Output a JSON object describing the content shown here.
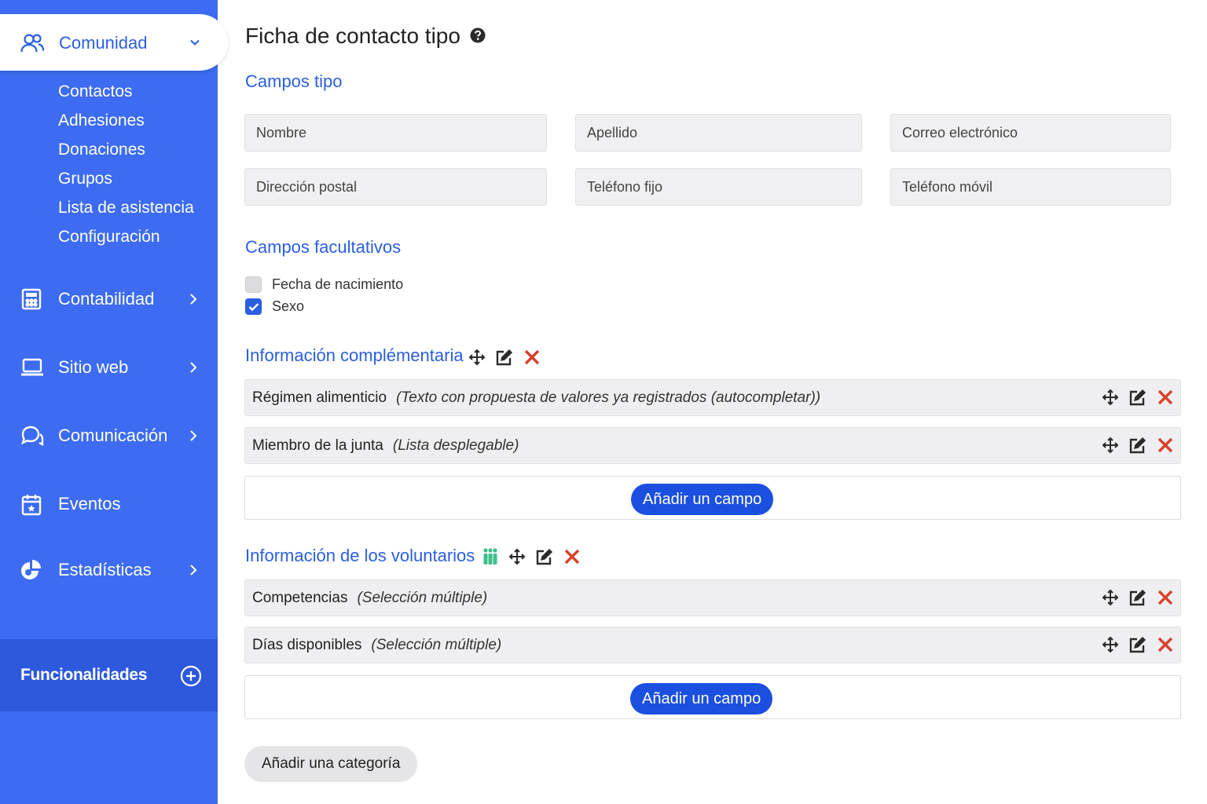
{
  "sidebar": {
    "active": {
      "label": "Comunidad",
      "icon": "community-icon"
    },
    "sub_items": [
      "Contactos",
      "Adhesiones",
      "Donaciones",
      "Grupos",
      "Lista de asistencia",
      "Configuración"
    ],
    "nav": [
      {
        "label": "Contabilidad",
        "icon": "calculator-icon",
        "has_chevron": true
      },
      {
        "label": "Sitio web",
        "icon": "laptop-icon",
        "has_chevron": true
      },
      {
        "label": "Comunicación",
        "icon": "chat-icon",
        "has_chevron": true
      },
      {
        "label": "Eventos",
        "icon": "calendar-icon",
        "has_chevron": false
      },
      {
        "label": "Estadísticas",
        "icon": "pie-chart-icon",
        "has_chevron": true
      }
    ],
    "features": {
      "label": "Funcionalidades",
      "icon": "plus-circle-icon"
    }
  },
  "main": {
    "title": "Ficha de contacto tipo",
    "standard": {
      "title": "Campos tipo",
      "fields": [
        "Nombre",
        "Apellido",
        "Correo electrónico",
        "Dirección postal",
        "Teléfono fijo",
        "Teléfono móvil"
      ]
    },
    "optional": {
      "title": "Campos facultativos",
      "items": [
        {
          "label": "Fecha de nacimiento",
          "checked": false
        },
        {
          "label": "Sexo",
          "checked": true
        }
      ]
    },
    "category1": {
      "title": "Información complémentaria",
      "rows": [
        {
          "name": "Régimen alimenticio",
          "type": "(Texto con propuesta de valores ya registrados (autocompletar))"
        },
        {
          "name": "Miembro de la junta",
          "type": "(Lista desplegable)"
        }
      ],
      "add_label": "Añadir un campo"
    },
    "category2": {
      "title": "Información de los voluntarios",
      "rows": [
        {
          "name": "Competencias",
          "type": "(Selección múltiple)"
        },
        {
          "name": "Días disponibles",
          "type": "(Selección múltiple)"
        }
      ],
      "add_label": "Añadir un campo"
    },
    "add_category_label": "Añadir una categoría"
  },
  "colors": {
    "sidebar_bg": "#3d6cf2",
    "accent": "#2a5fe0",
    "button": "#1a4fe0",
    "delete": "#d9412b",
    "volunteer_icon": "#3fbf8a"
  }
}
